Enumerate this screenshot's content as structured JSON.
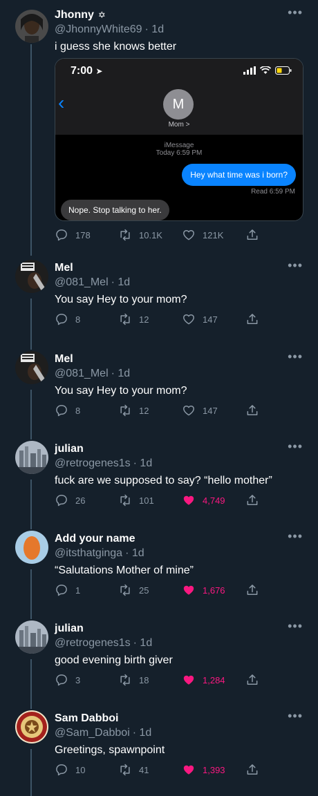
{
  "colors": {
    "background": "#15202b",
    "secondary_text": "#8b98a5",
    "like_active": "#f91880",
    "imessage_blue": "#0a84ff"
  },
  "main_tweet": {
    "name": "Jhonny",
    "badge": "✡",
    "handle": "@JhonnyWhite69",
    "time": "· 1d",
    "text": "i guess she knows better",
    "more": "•••",
    "screenshot": {
      "status_time": "7:00",
      "contact_initial": "M",
      "contact_name": "Mom >",
      "service": "iMessage",
      "sent_time": "Today 6:59 PM",
      "outgoing": "Hey what time was i born?",
      "read_receipt": "Read 6:59 PM",
      "incoming": "Nope. Stop talking to her."
    },
    "stats": {
      "replies": "178",
      "retweets": "10.1K",
      "likes": "121K"
    }
  },
  "replies": [
    {
      "name": "Mel",
      "handle": "@081_Mel",
      "time": "· 1d",
      "text": "You say Hey to your mom?",
      "replies": "8",
      "retweets": "12",
      "likes": "147",
      "liked": false
    },
    {
      "name": "Mel",
      "handle": "@081_Mel",
      "time": "· 1d",
      "text": "You say Hey to your mom?",
      "replies": "8",
      "retweets": "12",
      "likes": "147",
      "liked": false
    },
    {
      "name": "julian",
      "handle": "@retrogenes1s",
      "time": "· 1d",
      "text": "fuck are we supposed to say? “hello mother”",
      "replies": "26",
      "retweets": "101",
      "likes": "4,749",
      "liked": true
    },
    {
      "name": "Add your name",
      "handle": "@itsthatginga",
      "time": "· 1d",
      "text": "“Salutations Mother of mine”",
      "replies": "1",
      "retweets": "25",
      "likes": "1,676",
      "liked": true
    },
    {
      "name": "julian",
      "handle": "@retrogenes1s",
      "time": "· 1d",
      "text": "good evening birth giver",
      "replies": "3",
      "retweets": "18",
      "likes": "1,284",
      "liked": true
    },
    {
      "name": "Sam Dabboi",
      "handle": "@Sam_Dabboi",
      "time": "· 1d",
      "text": "Greetings, spawnpoint",
      "replies": "10",
      "retweets": "41",
      "likes": "1,393",
      "liked": true
    }
  ]
}
